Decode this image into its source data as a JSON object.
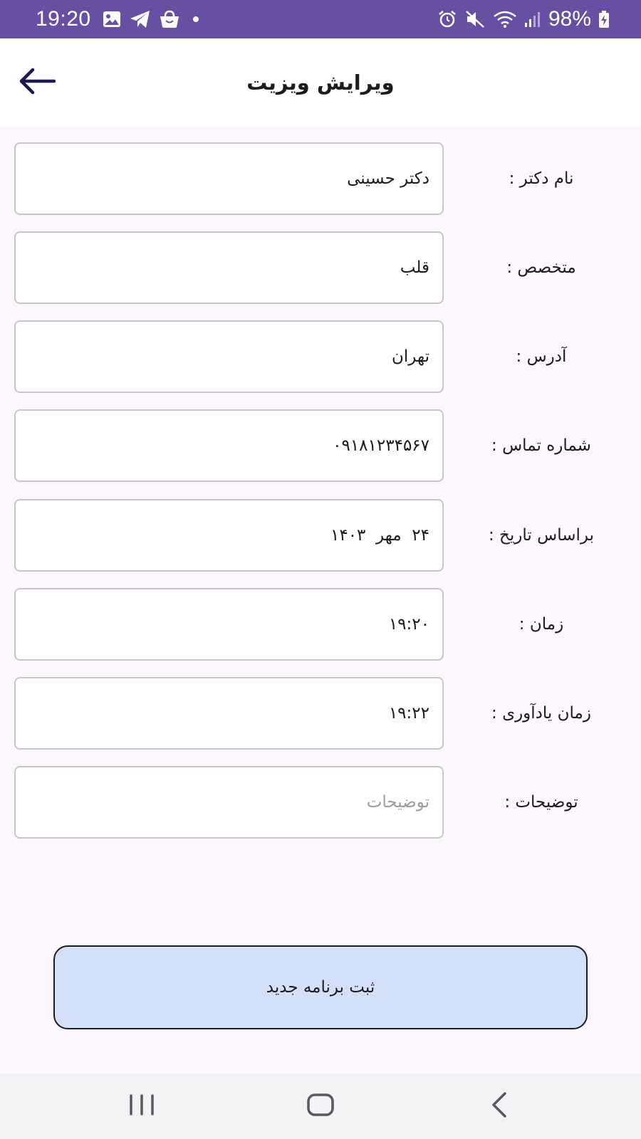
{
  "status_bar": {
    "time": "19:20",
    "battery": "98%",
    "left_icons": [
      "image-icon",
      "telegram-icon",
      "shopping-bag-icon",
      "notification-dot-icon"
    ],
    "right_icons": [
      "alarm-icon",
      "mute-icon",
      "wifi-icon",
      "signal-icon",
      "battery-charging-icon"
    ]
  },
  "app_bar": {
    "title": "ویرایش ویزیت",
    "back_icon": "arrow-left-icon"
  },
  "form": {
    "fields": [
      {
        "label": "نام دکتر  :",
        "value": "دکتر حسینی",
        "placeholder": ""
      },
      {
        "label": "متخصص  :",
        "value": "قلب",
        "placeholder": ""
      },
      {
        "label": "آدرس  :",
        "value": "تهران",
        "placeholder": ""
      },
      {
        "label": "شماره تماس  :",
        "value": "۰۹۱۸۱۲۳۴۵۶۷",
        "placeholder": ""
      },
      {
        "label": "براساس تاریخ  :",
        "value": "۲۴  مهر  ۱۴۰۳",
        "placeholder": ""
      },
      {
        "label": "زمان  :",
        "value": "۱۹:۲۰",
        "placeholder": ""
      },
      {
        "label": "زمان یادآوری :",
        "value": "۱۹:۲۲",
        "placeholder": ""
      },
      {
        "label": "توضیحات :",
        "value": "",
        "placeholder": "توضیحات"
      }
    ]
  },
  "submit": {
    "label": "ثبت برنامه جدید"
  },
  "nav_bar": {
    "icons": [
      "recent-apps-icon",
      "home-icon",
      "back-icon"
    ]
  },
  "colors": {
    "status_bar": "#6750a4",
    "page_background": "#fcf6fd",
    "button_background": "#d3e0f7",
    "field_border": "#c9c5cc"
  }
}
